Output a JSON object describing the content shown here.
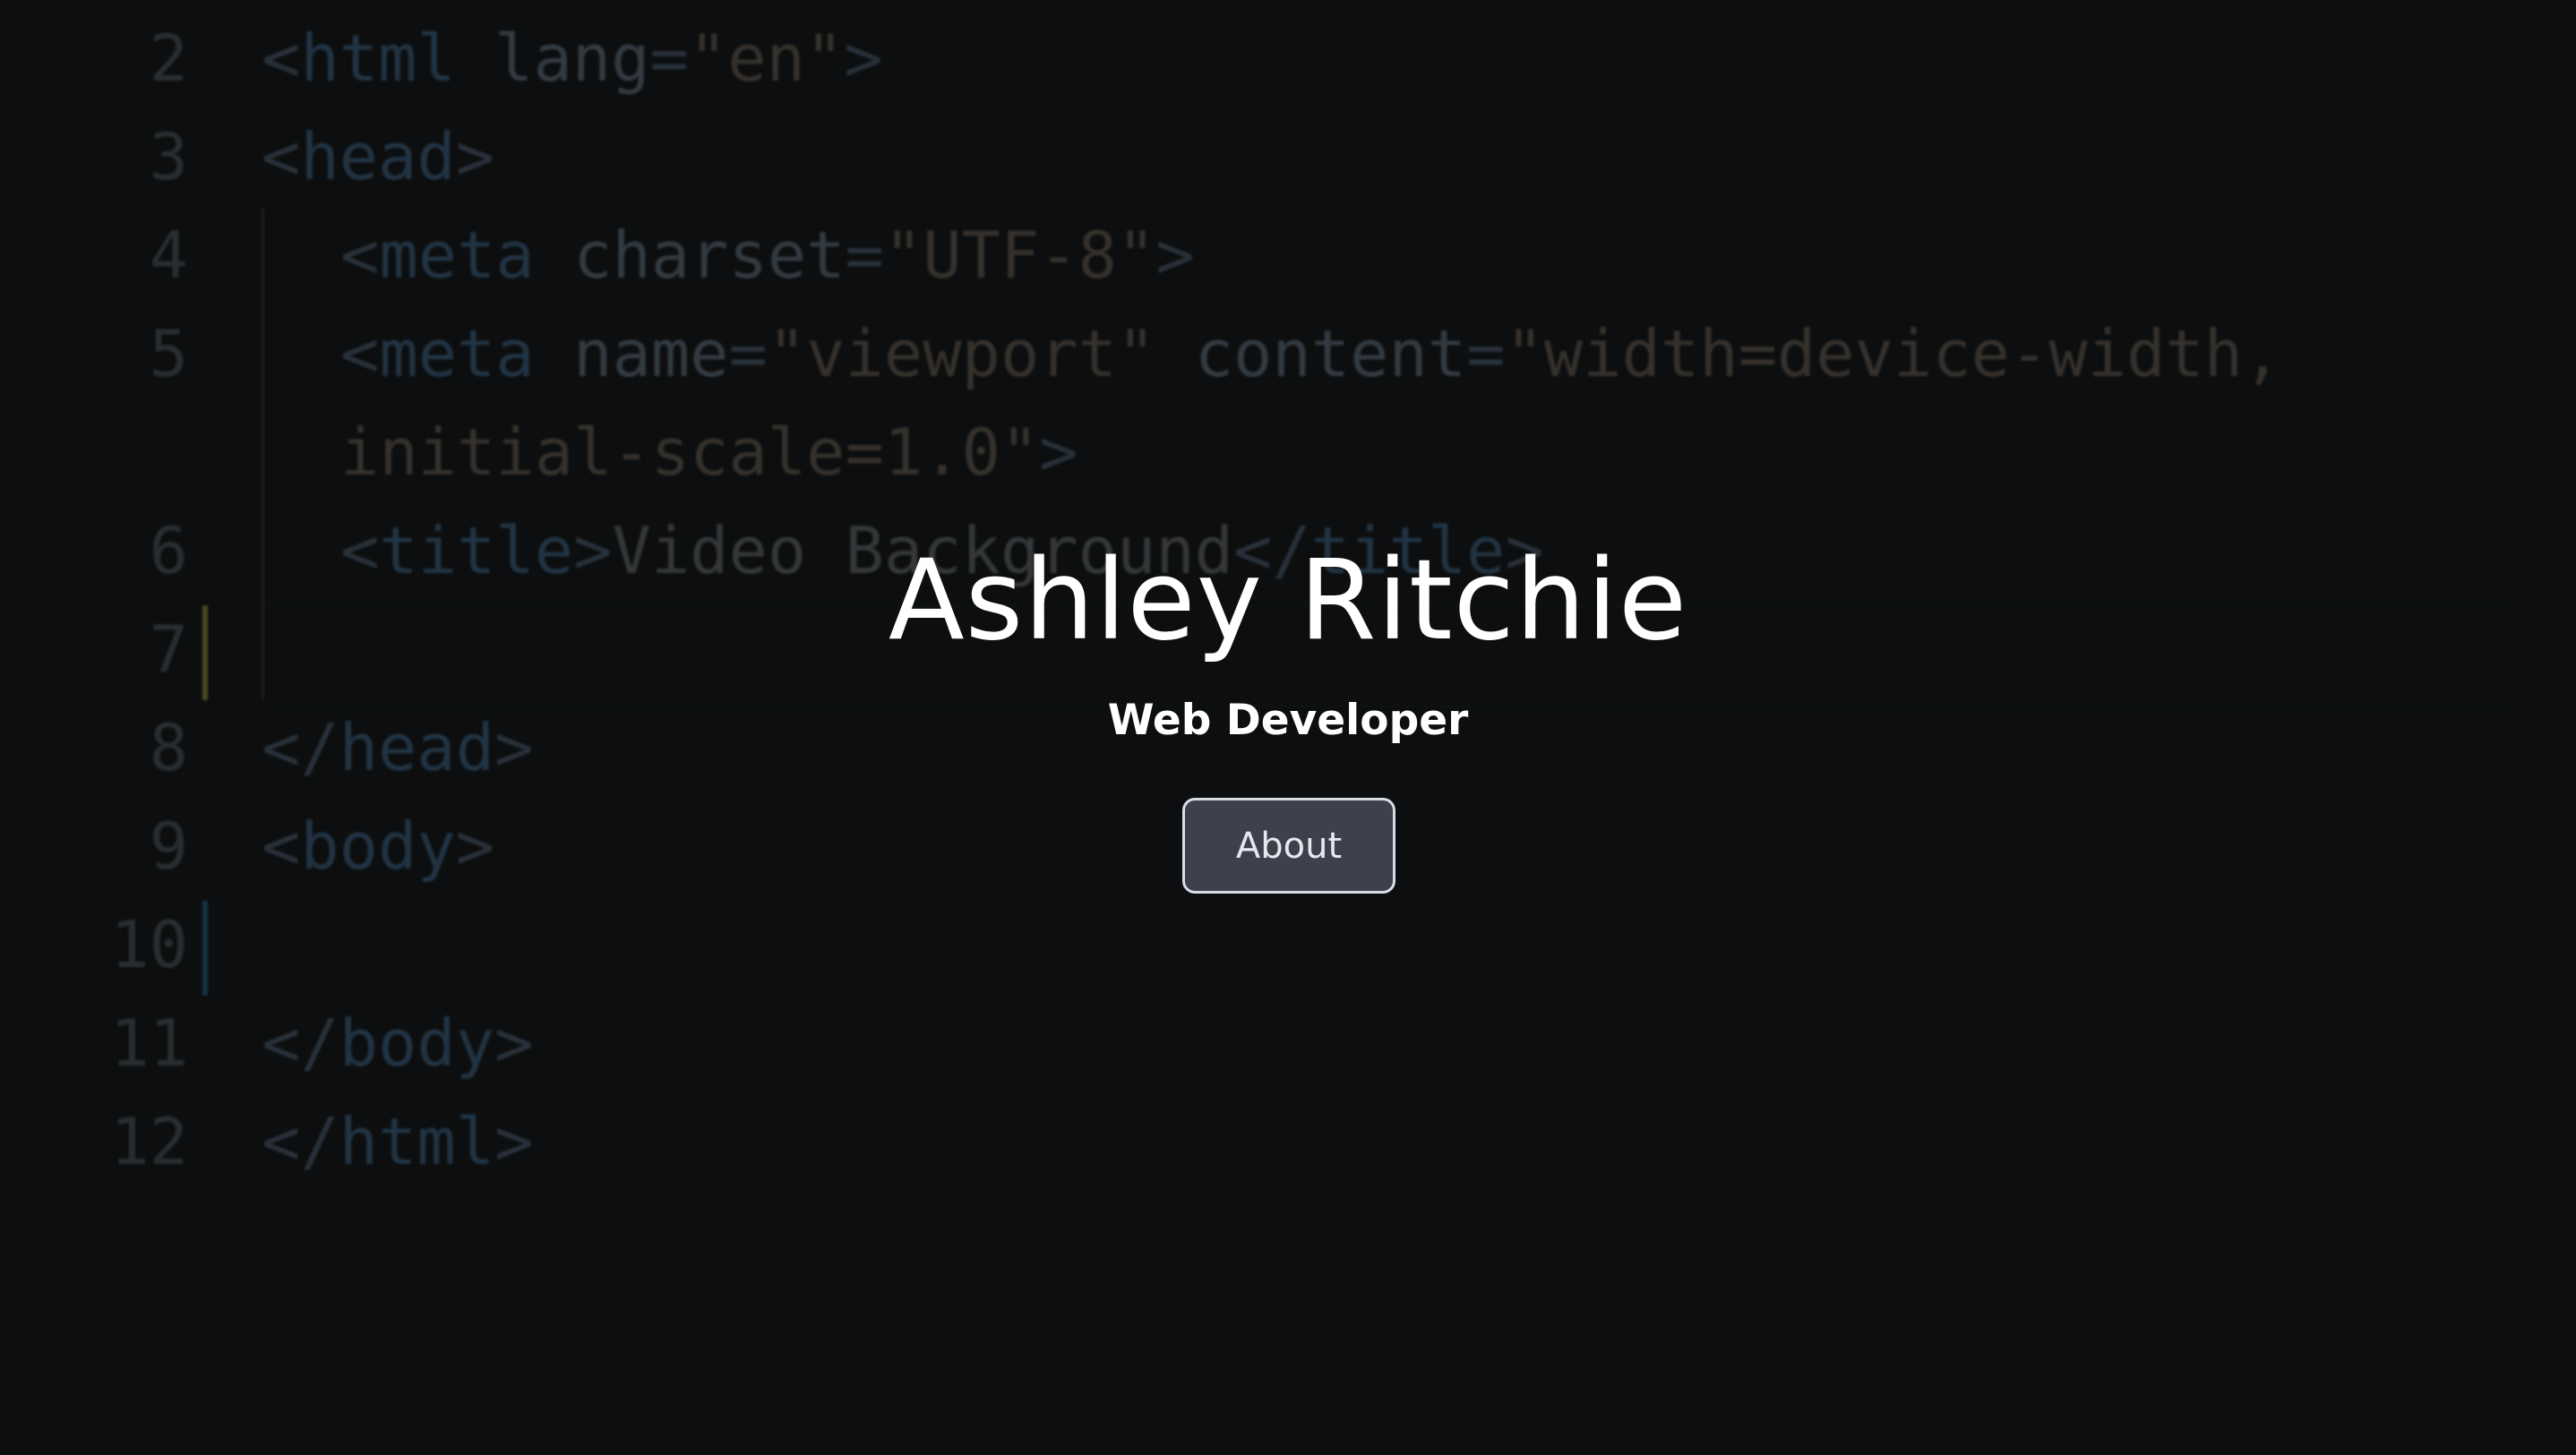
{
  "background_code": {
    "lines": [
      {
        "num": "2",
        "parts": [
          [
            "tag",
            "<"
          ],
          [
            "tname",
            "html"
          ],
          [
            "txt",
            " "
          ],
          [
            "attr",
            "lang"
          ],
          [
            "tag",
            "="
          ],
          [
            "str",
            "\"en\""
          ],
          [
            "tag",
            ">"
          ]
        ]
      },
      {
        "num": "3",
        "parts": [
          [
            "tag",
            "<"
          ],
          [
            "tname",
            "head"
          ],
          [
            "tag",
            ">"
          ]
        ]
      },
      {
        "num": "4",
        "parts": [
          [
            "tag",
            "<"
          ],
          [
            "tname",
            "meta"
          ],
          [
            "txt",
            " "
          ],
          [
            "attr",
            "charset"
          ],
          [
            "tag",
            "="
          ],
          [
            "str",
            "\"UTF-8\""
          ],
          [
            "tag",
            ">"
          ]
        ]
      },
      {
        "num": "5",
        "parts": [
          [
            "tag",
            "<"
          ],
          [
            "tname",
            "meta"
          ],
          [
            "txt",
            " "
          ],
          [
            "attr",
            "name"
          ],
          [
            "tag",
            "="
          ],
          [
            "str",
            "\"viewport\""
          ],
          [
            "txt",
            " "
          ],
          [
            "attr",
            "content"
          ],
          [
            "tag",
            "="
          ],
          [
            "str",
            "\"width=device-width,"
          ]
        ]
      },
      {
        "num": "",
        "parts": [
          [
            "str",
            "initial-scale=1.0\""
          ],
          [
            "tag",
            ">"
          ]
        ]
      },
      {
        "num": "6",
        "parts": [
          [
            "tag",
            "<"
          ],
          [
            "tname",
            "title"
          ],
          [
            "tag",
            ">"
          ],
          [
            "txt",
            "Video Background"
          ],
          [
            "tag",
            "</"
          ],
          [
            "tname",
            "title"
          ],
          [
            "tag",
            ">"
          ]
        ]
      },
      {
        "num": "7",
        "parts": []
      },
      {
        "num": "8",
        "parts": [
          [
            "tag",
            "</"
          ],
          [
            "tname",
            "head"
          ],
          [
            "tag",
            ">"
          ]
        ]
      },
      {
        "num": "9",
        "parts": [
          [
            "tag",
            "<"
          ],
          [
            "tname",
            "body"
          ],
          [
            "tag",
            ">"
          ]
        ]
      },
      {
        "num": "10",
        "parts": []
      },
      {
        "num": "11",
        "parts": [
          [
            "tag",
            "</"
          ],
          [
            "tname",
            "body"
          ],
          [
            "tag",
            ">"
          ]
        ]
      },
      {
        "num": "12",
        "parts": [
          [
            "tag",
            "</"
          ],
          [
            "tname",
            "html"
          ],
          [
            "tag",
            ">"
          ]
        ]
      }
    ]
  },
  "hero": {
    "name": "Ashley Ritchie",
    "role": "Web Developer",
    "about_label": "About"
  },
  "colors": {
    "background": "#0f1011",
    "button_bg": "#3d404d",
    "button_border": "#d9dce3",
    "text": "#ffffff"
  }
}
